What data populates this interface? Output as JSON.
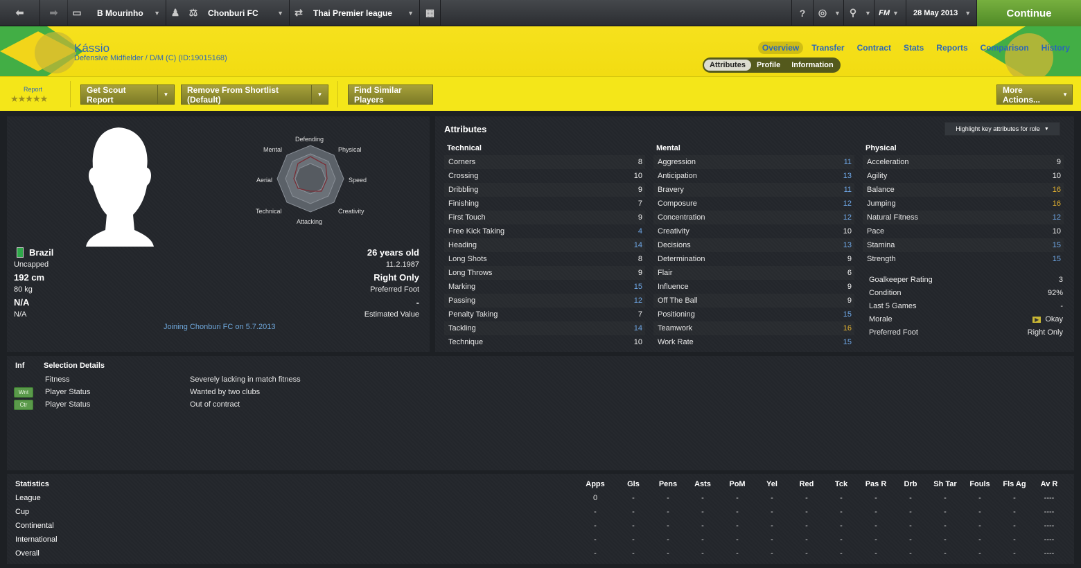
{
  "topbar": {
    "manager": "B Mourinho",
    "club": "Chonburi FC",
    "league": "Thai Premier league",
    "date": "28 May 2013",
    "continue_label": "Continue",
    "icons": [
      "back-arrow-icon",
      "forward-arrow-icon",
      "inbox-icon",
      "manager-icon",
      "club-icon",
      "transfer-icon",
      "calendar-icon",
      "help-icon",
      "globe-icon",
      "search-icon",
      "fm-menu-icon"
    ],
    "fm_label": "FM"
  },
  "player": {
    "name": "Kássio",
    "subtitle": "Defensive Midfielder / D/M (C) (ID:19015168)",
    "nationality": "Brazil",
    "caps": "Uncapped",
    "height": "192 cm",
    "weight": "80 kg",
    "na1": "N/A",
    "na2": "N/A",
    "age": "26 years old",
    "dob": "11.2.1987",
    "foot": "Right Only",
    "foot_label": "Preferred Foot",
    "value": "-",
    "value_label": "Estimated Value",
    "joining": "Joining Chonburi FC on 5.7.2013"
  },
  "nav": {
    "tabs": [
      "Overview",
      "Transfer",
      "Contract",
      "Stats",
      "Reports",
      "Comparison",
      "History"
    ],
    "active": "Overview",
    "subtabs": [
      "Attributes",
      "Profile",
      "Information"
    ]
  },
  "actions": {
    "report_label": "Report",
    "stars": "★★★★★",
    "scout": "Get Scout Report",
    "shortlist": "Remove From Shortlist (Default)",
    "similar": "Find Similar Players",
    "more": "More Actions..."
  },
  "radar": {
    "labels": [
      "Defending",
      "Physical",
      "Speed",
      "Creativity",
      "Attacking",
      "Technical",
      "Aerial",
      "Mental"
    ]
  },
  "attributes": {
    "title": "Attributes",
    "highlight": "Highlight key attributes for role",
    "technical": {
      "heading": "Technical",
      "rows": [
        {
          "label": "Corners",
          "value": "8",
          "tone": "white"
        },
        {
          "label": "Crossing",
          "value": "10",
          "tone": "white"
        },
        {
          "label": "Dribbling",
          "value": "9",
          "tone": "white"
        },
        {
          "label": "Finishing",
          "value": "7",
          "tone": "white"
        },
        {
          "label": "First Touch",
          "value": "9",
          "tone": "white"
        },
        {
          "label": "Free Kick Taking",
          "value": "4",
          "tone": "blue"
        },
        {
          "label": "Heading",
          "value": "14",
          "tone": "blue"
        },
        {
          "label": "Long Shots",
          "value": "8",
          "tone": "white"
        },
        {
          "label": "Long Throws",
          "value": "9",
          "tone": "white"
        },
        {
          "label": "Marking",
          "value": "15",
          "tone": "blue"
        },
        {
          "label": "Passing",
          "value": "12",
          "tone": "blue"
        },
        {
          "label": "Penalty Taking",
          "value": "7",
          "tone": "white"
        },
        {
          "label": "Tackling",
          "value": "14",
          "tone": "blue"
        },
        {
          "label": "Technique",
          "value": "10",
          "tone": "white"
        }
      ]
    },
    "mental": {
      "heading": "Mental",
      "rows": [
        {
          "label": "Aggression",
          "value": "11",
          "tone": "blue"
        },
        {
          "label": "Anticipation",
          "value": "13",
          "tone": "blue"
        },
        {
          "label": "Bravery",
          "value": "11",
          "tone": "blue"
        },
        {
          "label": "Composure",
          "value": "12",
          "tone": "blue"
        },
        {
          "label": "Concentration",
          "value": "12",
          "tone": "blue"
        },
        {
          "label": "Creativity",
          "value": "10",
          "tone": "white"
        },
        {
          "label": "Decisions",
          "value": "13",
          "tone": "blue"
        },
        {
          "label": "Determination",
          "value": "9",
          "tone": "white"
        },
        {
          "label": "Flair",
          "value": "6",
          "tone": "white"
        },
        {
          "label": "Influence",
          "value": "9",
          "tone": "white"
        },
        {
          "label": "Off The Ball",
          "value": "9",
          "tone": "white"
        },
        {
          "label": "Positioning",
          "value": "15",
          "tone": "blue"
        },
        {
          "label": "Teamwork",
          "value": "16",
          "tone": "gold"
        },
        {
          "label": "Work Rate",
          "value": "15",
          "tone": "blue"
        }
      ]
    },
    "physical": {
      "heading": "Physical",
      "rows": [
        {
          "label": "Acceleration",
          "value": "9",
          "tone": "white"
        },
        {
          "label": "Agility",
          "value": "10",
          "tone": "white"
        },
        {
          "label": "Balance",
          "value": "16",
          "tone": "gold"
        },
        {
          "label": "Jumping",
          "value": "16",
          "tone": "gold"
        },
        {
          "label": "Natural Fitness",
          "value": "12",
          "tone": "blue"
        },
        {
          "label": "Pace",
          "value": "10",
          "tone": "white"
        },
        {
          "label": "Stamina",
          "value": "15",
          "tone": "blue"
        },
        {
          "label": "Strength",
          "value": "15",
          "tone": "blue"
        }
      ],
      "extra": [
        {
          "label": "Goalkeeper Rating",
          "value": "3"
        },
        {
          "label": "Condition",
          "value": "92%"
        },
        {
          "label": "Last 5 Games",
          "value": "-"
        },
        {
          "label": "Morale",
          "value": "Okay"
        },
        {
          "label": "Preferred Foot",
          "value": "Right Only"
        }
      ]
    }
  },
  "selection": {
    "inf_label": "Inf",
    "heading": "Selection Details",
    "rows": [
      {
        "badge": "",
        "label": "Fitness",
        "detail": "Severely lacking in match fitness"
      },
      {
        "badge": "Wnt",
        "label": "Player Status",
        "detail": "Wanted by two clubs"
      },
      {
        "badge": "Ctr",
        "label": "Player Status",
        "detail": "Out of contract"
      }
    ]
  },
  "statistics": {
    "heading": "Statistics",
    "columns": [
      "Apps",
      "Gls",
      "Pens",
      "Asts",
      "PoM",
      "Yel",
      "Red",
      "Tck",
      "Pas R",
      "Drb",
      "Sh Tar",
      "Fouls",
      "Fls Ag",
      "Av R"
    ],
    "rows": [
      {
        "label": "League",
        "values": [
          "0",
          "-",
          "-",
          "-",
          "-",
          "-",
          "-",
          "-",
          "-",
          "-",
          "-",
          "-",
          "-",
          "----"
        ]
      },
      {
        "label": "Cup",
        "values": [
          "-",
          "-",
          "-",
          "-",
          "-",
          "-",
          "-",
          "-",
          "-",
          "-",
          "-",
          "-",
          "-",
          "----"
        ]
      },
      {
        "label": "Continental",
        "values": [
          "-",
          "-",
          "-",
          "-",
          "-",
          "-",
          "-",
          "-",
          "-",
          "-",
          "-",
          "-",
          "-",
          "----"
        ]
      },
      {
        "label": "International",
        "values": [
          "-",
          "-",
          "-",
          "-",
          "-",
          "-",
          "-",
          "-",
          "-",
          "-",
          "-",
          "-",
          "-",
          "----"
        ]
      },
      {
        "label": "Overall",
        "values": [
          "-",
          "-",
          "-",
          "-",
          "-",
          "-",
          "-",
          "-",
          "-",
          "-",
          "-",
          "-",
          "-",
          "----"
        ]
      }
    ]
  },
  "colors": {
    "header_yellow": "#f6e11d",
    "brand_green": "#5a9a3a",
    "link_blue": "#2c67b8",
    "value_blue": "#6fa8e8",
    "value_gold": "#e0b030"
  }
}
